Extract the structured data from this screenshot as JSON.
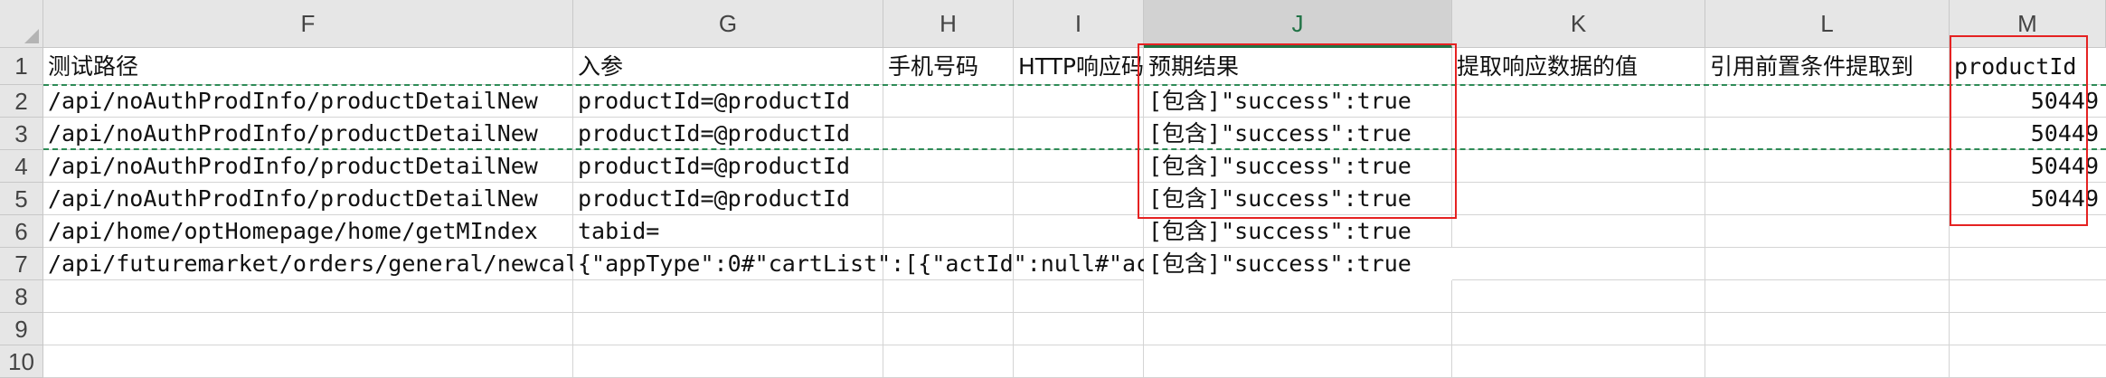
{
  "columns": [
    {
      "letter": "F",
      "active": false
    },
    {
      "letter": "G",
      "active": false
    },
    {
      "letter": "H",
      "active": false
    },
    {
      "letter": "I",
      "active": false
    },
    {
      "letter": "J",
      "active": true
    },
    {
      "letter": "K",
      "active": false
    },
    {
      "letter": "L",
      "active": false
    },
    {
      "letter": "M",
      "active": false
    }
  ],
  "rows": [
    "1",
    "2",
    "3",
    "4",
    "5",
    "6",
    "7",
    "8",
    "9",
    "10"
  ],
  "headers": {
    "F": "测试路径",
    "G": "入参",
    "H": "手机号码",
    "I": "HTTP响应码",
    "J": "预期结果",
    "K": "提取响应数据的值",
    "L": "引用前置条件提取到",
    "M": "productId"
  },
  "data_rows": [
    {
      "F": "/api/noAuthProdInfo/productDetailNew",
      "G": "productId=@productId",
      "J": "[包含]\"success\":true",
      "M": "50449"
    },
    {
      "F": "/api/noAuthProdInfo/productDetailNew",
      "G": "productId=@productId",
      "J": "[包含]\"success\":true",
      "M": "50449"
    },
    {
      "F": "/api/noAuthProdInfo/productDetailNew",
      "G": "productId=@productId",
      "J": "[包含]\"success\":true",
      "M": "50449"
    },
    {
      "F": "/api/noAuthProdInfo/productDetailNew",
      "G": "productId=@productId",
      "J": "[包含]\"success\":true",
      "M": "50449"
    },
    {
      "F": "/api/home/optHomepage/home/getMIndex",
      "G": "tabid=",
      "J": "[包含]\"success\":true",
      "M": ""
    },
    {
      "F": "/api/futuremarket/orders/general/newcal",
      "G": "{\"appType\":0#\"cartList\":[{\"actId\":null#\"ac",
      "J": "[包含]\"success\":true",
      "M": ""
    }
  ],
  "colors": {
    "active_column": "#217346",
    "highlight_box": "#e52222",
    "copy_marquee": "#2e8b57"
  }
}
